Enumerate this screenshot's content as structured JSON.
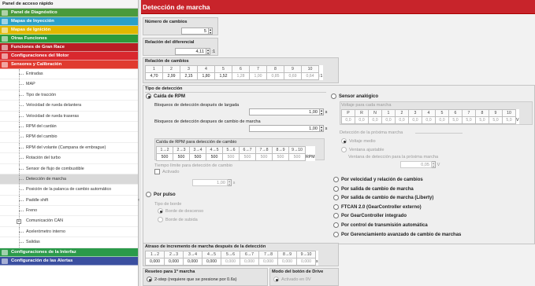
{
  "sidebar": {
    "title": "Panel de acceso rápido",
    "categories": [
      {
        "label": "Panel de Diagnóstico",
        "color": "#4a9a3c",
        "icon": "checkmark-icon"
      },
      {
        "label": "Mapas de Inyección",
        "color": "#2aa0c8",
        "icon": "injector-icon"
      },
      {
        "label": "Mapas de Ignición",
        "color": "#e0b800",
        "icon": "spark-icon"
      },
      {
        "label": "Otras Funciones",
        "color": "#2d9a3a",
        "icon": "tools-icon"
      },
      {
        "label": "Funciones de Gran Race",
        "color": "#b81e24",
        "icon": "flag-icon"
      },
      {
        "label": "Configuraciones del Motor",
        "color": "#d9282e",
        "icon": "engine-icon"
      },
      {
        "label": "Sensores y Calibración",
        "color": "#e03a2e",
        "icon": "sensor-icon"
      }
    ],
    "items": [
      "Entradas",
      "MAP",
      "Tipo de tracción",
      "Velocidad de rueda delantera",
      "Velocidad de rueda traseras",
      "RPM del cardán",
      "RPM del cambio",
      "RPM del volante (Campana de embrague)",
      "Rotación del turbo",
      "Sensor de flujo de combustible",
      "Detección de marcha",
      "Posición de la palanca de cambio automático",
      "Paddle shift",
      "Freno",
      "Comunicación CAN",
      "Acelerómetro interno",
      "Salidas"
    ],
    "selected": "Detección de marcha",
    "bottom": [
      {
        "label": "Configuraciones de la Interfaz",
        "color": "#2b9a4a",
        "icon": "monitor-icon"
      },
      {
        "label": "Configuración de las Alertas",
        "color": "#3b4fa0",
        "icon": "bell-icon"
      }
    ]
  },
  "main": {
    "title": "Detección de marcha",
    "num_gears_label": "Número de cambios",
    "num_gears": "5",
    "diff_label": "Relación del diferencial",
    "diff_value": "4,11",
    "diff_unit": ":1",
    "ratios_label": "Relación de cambios",
    "ratio_headers": [
      "1",
      "2",
      "3",
      "4",
      "5",
      "6",
      "7",
      "8",
      "9",
      "10"
    ],
    "ratio_values": [
      "4,70",
      "2,99",
      "2,15",
      "1,80",
      "1,52",
      "1,28",
      "1,00",
      "0,85",
      "0,69",
      "0,64"
    ],
    "ratio_unit": ":1",
    "detection_type_label": "Tipo de detección",
    "rpm_drop_label": "Caída de RPM",
    "launch_block_label": "Bloqueos de detección después de largada",
    "launch_block": "1,00",
    "sec_unit": "s",
    "shift_block_label": "Bloqueos de detección despues de cambio de marcha",
    "shift_block": "1,00",
    "rpm_drop_table_label": "Caída de RPM para detección de cambio",
    "rpm_drop_headers": [
      "1→2",
      "2→3",
      "3→4",
      "4→5",
      "5→6",
      "6→7",
      "7→8",
      "8→9",
      "9→10"
    ],
    "rpm_drop_values": [
      "500",
      "500",
      "500",
      "500",
      "500",
      "500",
      "500",
      "500",
      "500"
    ],
    "rpm_unit": "RPM",
    "time_limit_label": "Tiempo límite para detección de cambio",
    "activated_label": "Activado",
    "time_limit": "1,00",
    "pulse_label": "Por pulso",
    "edge_type_label": "Tipo de borde",
    "falling_edge": "Borde de descenso",
    "rising_edge": "Borde de subida",
    "analog_label": "Sensor analógico",
    "voltage_label": "Voltaje para cada marcha",
    "voltage_headers": [
      "P",
      "R",
      "N",
      "1",
      "2",
      "3",
      "4",
      "5",
      "6",
      "7",
      "8",
      "9",
      "10"
    ],
    "voltage_values": [
      "0,0",
      "0,0",
      "0,0",
      "0,0",
      "0,0",
      "0,0",
      "0,0",
      "0,0",
      "5,0",
      "5,0",
      "5,0",
      "5,0",
      "5,0"
    ],
    "voltage_unit": "V",
    "next_gear_label": "Detección de la próxima marcha",
    "mid_voltage": "Voltaje medio",
    "adjustable_window": "Ventana ajustable",
    "window_label": "Ventana de detección para la próxima marcha",
    "window_value": "0,05",
    "window_unit": "V",
    "options": [
      "Por velocidad y relación de cambios",
      "Por salida de cambio de marcha",
      "Por salida de cambio de marcha (Liberty)",
      "FTCAN 2.0 (GearController externo)",
      "Por GearController integrado",
      "Por control de transmisión automática",
      "Por Gerenciamiento avanzado de cambio de marchas"
    ],
    "delay_label": "Atraso de incremento de marcha después de la detección",
    "delay_headers": [
      "1→2",
      "2→3",
      "3→4",
      "4→5",
      "5→6",
      "6→7",
      "7→8",
      "8→9",
      "9→10"
    ],
    "delay_values": [
      "0,000",
      "0,000",
      "0,000",
      "0,000",
      "0,000",
      "0,000",
      "0,000",
      "0,000",
      "0,000"
    ],
    "delay_unit": "s",
    "reset_label": "Reseteo para 1ª marcha",
    "reset_option": "2-step (requiere que se presione por 0.6s)",
    "drive_label": "Modo del botón de Drive",
    "drive_option": "Activado en 0V"
  }
}
